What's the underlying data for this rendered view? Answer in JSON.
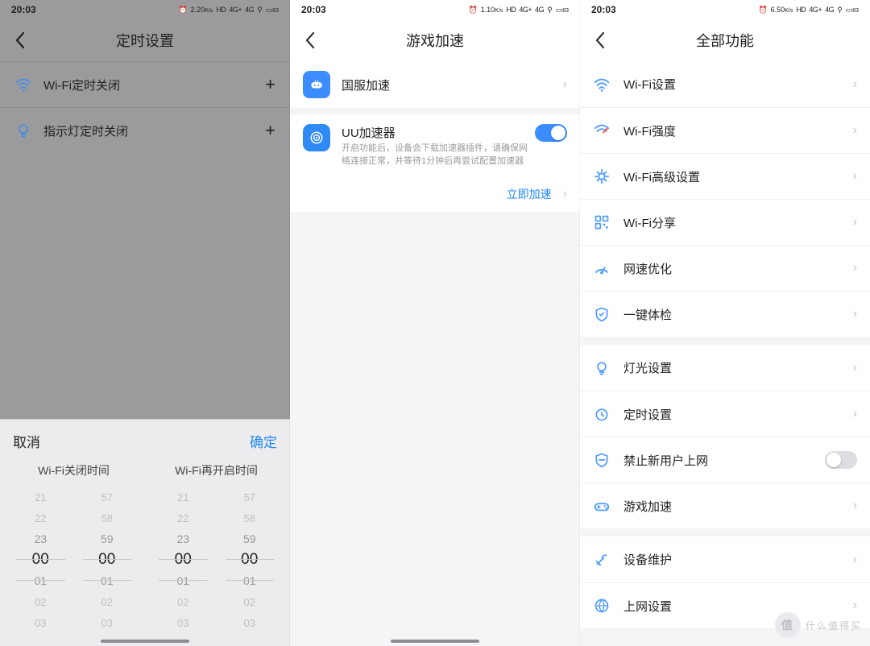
{
  "status": {
    "time": "20:03",
    "net_speed_1": "2.20",
    "net_speed_2": "1.10",
    "net_speed_3": "6.50",
    "net_unit": "K/s",
    "hd": "HD",
    "sig1": "4G+",
    "sig2": "4G",
    "batt": "83"
  },
  "pane1": {
    "title": "定时设置",
    "rows": [
      {
        "label": "Wi-Fi定时关闭"
      },
      {
        "label": "指示灯定时关闭"
      }
    ],
    "sheet": {
      "cancel": "取消",
      "confirm": "确定",
      "col1_title": "Wi-Fi关闭时间",
      "col2_title": "Wi-Fi再开启时间",
      "hours": [
        "21",
        "22",
        "23",
        "00",
        "01",
        "02",
        "03"
      ],
      "mins": [
        "57",
        "58",
        "59",
        "00",
        "01",
        "02",
        "03"
      ]
    }
  },
  "pane2": {
    "title": "游戏加速",
    "row1_title": "国服加速",
    "row2_title": "UU加速器",
    "row2_sub": "开启功能后，设备会下载加速器插件，请确保网络连接正常，并等待1分钟后再尝试配置加速器",
    "link": "立即加速"
  },
  "pane3": {
    "title": "全部功能",
    "g1": [
      {
        "k": "wifi-settings",
        "label": "Wi-Fi设置"
      },
      {
        "k": "wifi-strength",
        "label": "Wi-Fi强度"
      },
      {
        "k": "wifi-advanced",
        "label": "Wi-Fi高级设置"
      },
      {
        "k": "wifi-share",
        "label": "Wi-Fi分享"
      },
      {
        "k": "net-optimize",
        "label": "网速优化"
      },
      {
        "k": "health-check",
        "label": "一键体检"
      }
    ],
    "g2": [
      {
        "k": "light",
        "label": "灯光设置"
      },
      {
        "k": "timer",
        "label": "定时设置"
      },
      {
        "k": "block-new",
        "label": "禁止新用户上网",
        "toggle": true
      },
      {
        "k": "game-boost",
        "label": "游戏加速"
      }
    ],
    "g3": [
      {
        "k": "maintain",
        "label": "设备维护"
      },
      {
        "k": "net-settings",
        "label": "上网设置"
      }
    ]
  },
  "watermark": {
    "badge": "值",
    "text": "什么值得买"
  }
}
